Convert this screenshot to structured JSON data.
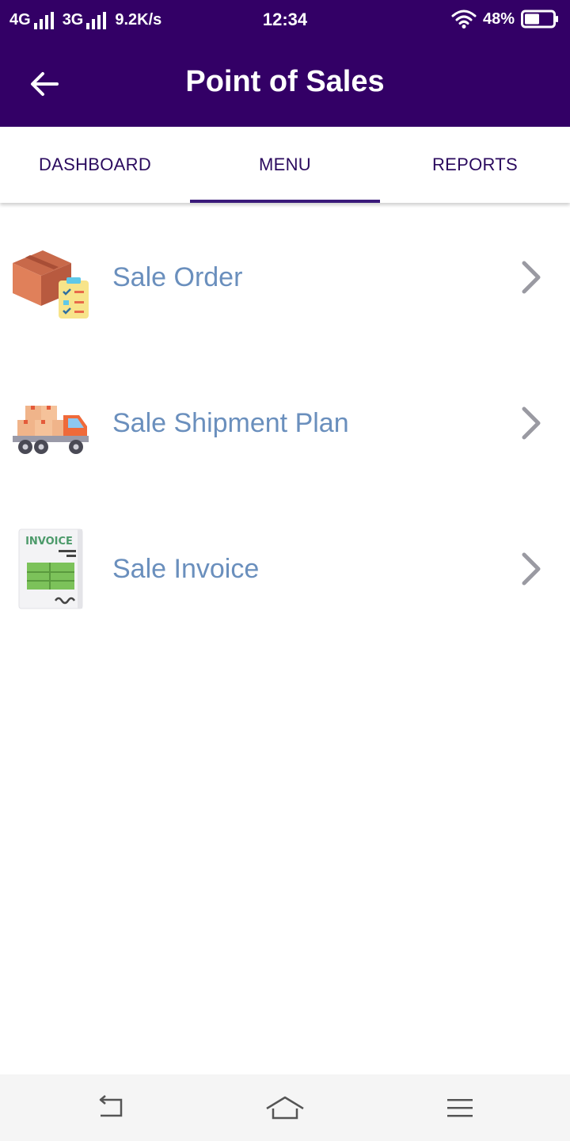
{
  "status_bar": {
    "network_1": "4G",
    "network_2": "3G",
    "speed": "9.2K/s",
    "time": "12:34",
    "battery": "48%"
  },
  "app_bar": {
    "title": "Point of Sales"
  },
  "tabs": [
    {
      "label": "DASHBOARD",
      "active": false
    },
    {
      "label": "MENU",
      "active": true
    },
    {
      "label": "REPORTS",
      "active": false
    }
  ],
  "menu": {
    "items": [
      {
        "label": "Sale Order",
        "icon": "sale-order-icon"
      },
      {
        "label": "Sale Shipment Plan",
        "icon": "delivery-truck-icon"
      },
      {
        "label": "Sale Invoice",
        "icon": "invoice-icon"
      }
    ],
    "invoice_icon_text": "INVOICE"
  },
  "colors": {
    "primary": "#330066",
    "label": "#6a8fbd",
    "tab_text": "#2a0a5e",
    "chevron": "#9a9aa2"
  }
}
